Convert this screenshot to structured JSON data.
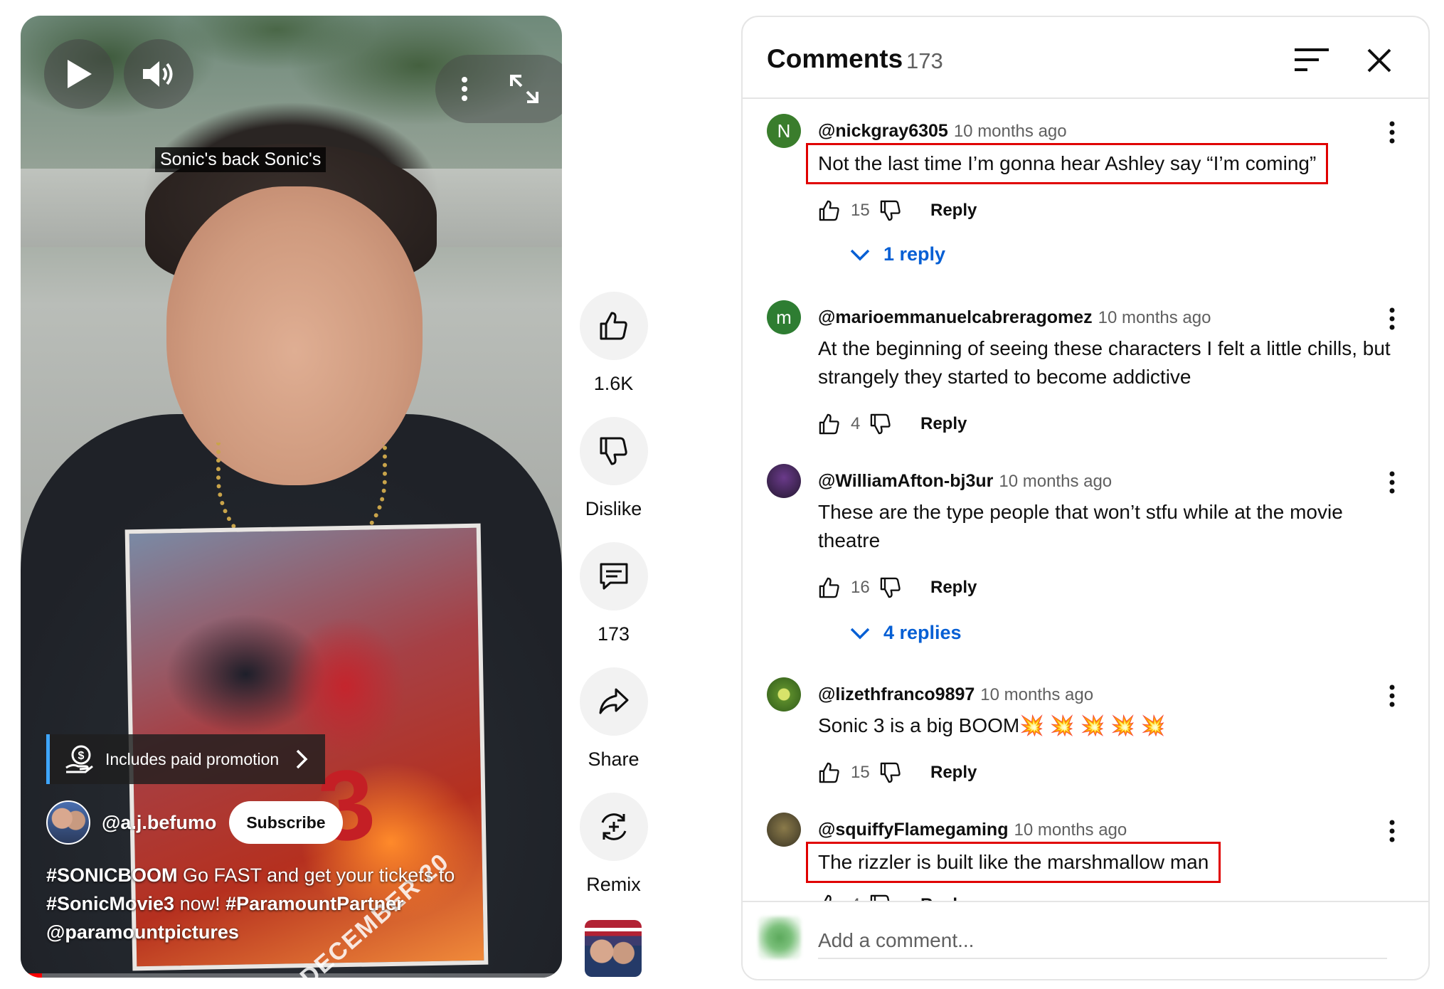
{
  "video": {
    "caption": "Sonic's back Sonic's",
    "poster_number": "3",
    "poster_text": "DECEMBER 20",
    "promo_label": "Includes paid promotion",
    "channel_handle": "@a.j.befumo",
    "subscribe_label": "Subscribe",
    "desc_tag1": "#SONICBOOM",
    "desc_text1": " Go FAST and get your tickets to ",
    "desc_tag2": "#SonicMovie3",
    "desc_text2": " now! ",
    "desc_tag3": "#ParamountPartner",
    "desc_mention": "@paramountpictures",
    "progress_fraction": 0.04
  },
  "actions": {
    "like_count": "1.6K",
    "dislike_label": "Dislike",
    "comment_count": "173",
    "share_label": "Share",
    "remix_label": "Remix"
  },
  "comments_panel": {
    "title": "Comments",
    "count": "173",
    "add_placeholder": "Add a comment...",
    "reply_label": "Reply",
    "comments": [
      {
        "avatar_letter": "N",
        "avatar_color": "#3a7d2c",
        "user": "@nickgray6305",
        "ago": "10 months ago",
        "text": "Not the last time I’m gonna hear Ashley say “I’m coming”",
        "likes": "15",
        "replies": "1 reply",
        "highlighted": true
      },
      {
        "avatar_letter": "m",
        "avatar_color": "#2e7d32",
        "user": "@marioemmanuelcabreragomez",
        "ago": "10 months ago",
        "text": "At the beginning of seeing these characters I felt a little chills, but strangely they started to become addictive",
        "likes": "4"
      },
      {
        "avatar_letter": "",
        "avatar_color": "#3b2a4a",
        "user": "@WilliamAfton-bj3ur",
        "ago": "10 months ago",
        "text": "These are the type people that won’t stfu while at the movie theatre",
        "likes": "16",
        "replies": "4 replies"
      },
      {
        "avatar_letter": "",
        "avatar_color": "#6a9a3a",
        "user": "@lizethfranco9897",
        "ago": "10 months ago",
        "text": "Sonic 3 is a big BOOM💥 💥 💥 💥 💥",
        "likes": "15"
      },
      {
        "avatar_letter": "",
        "avatar_color": "#5a5238",
        "user": "@squiffyFlamegaming",
        "ago": "10 months ago",
        "text": "The rizzler is built like the marshmallow man",
        "likes": "4",
        "highlighted": true
      }
    ]
  },
  "colors": {
    "highlight_box": "#e00000",
    "link_blue": "#065fd4",
    "progress_red": "#ff0000"
  }
}
